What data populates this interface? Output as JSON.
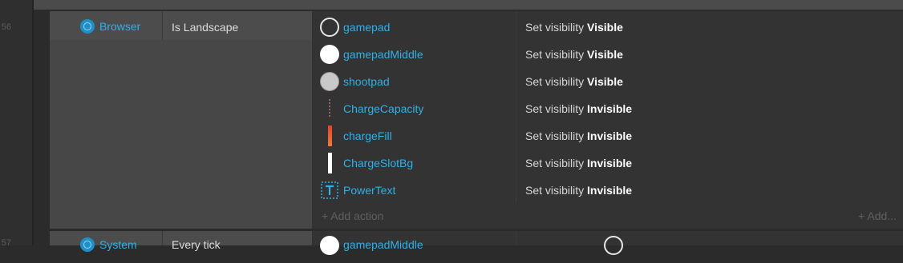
{
  "gutter": {
    "line_a": "56",
    "line_b": "57"
  },
  "event": {
    "object_label": "Browser",
    "condition_text": "Is Landscape",
    "actions": [
      {
        "target": "gamepad",
        "prefix": "Set visibility",
        "value": "Visible",
        "icon": "outline-circle-icon"
      },
      {
        "target": "gamepadMiddle",
        "prefix": "Set visibility",
        "value": "Visible",
        "icon": "white-circle-icon"
      },
      {
        "target": "shootpad",
        "prefix": "Set visibility",
        "value": "Visible",
        "icon": "gray-circle-icon"
      },
      {
        "target": "ChargeCapacity",
        "prefix": "Set visibility",
        "value": "Invisible",
        "icon": "dotted-bar-icon"
      },
      {
        "target": "chargeFill",
        "prefix": "Set visibility",
        "value": "Invisible",
        "icon": "red-bar-icon"
      },
      {
        "target": "ChargeSlotBg",
        "prefix": "Set visibility",
        "value": "Invisible",
        "icon": "white-bar-icon"
      },
      {
        "target": "PowerText",
        "prefix": "Set visibility",
        "value": "Invisible",
        "icon": "text-icon"
      }
    ],
    "add_action": "+ Add action",
    "add_right": "+ Add..."
  },
  "event2": {
    "object_label": "System",
    "condition_text": "Every tick",
    "action_target": "gamepadMiddle"
  },
  "colors": {
    "link": "#2fb0e8",
    "charge_fill": "#e8432a"
  }
}
